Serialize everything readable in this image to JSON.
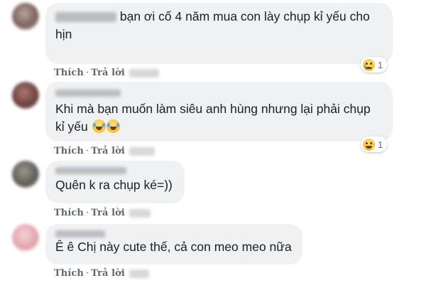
{
  "comments": [
    {
      "text": "bạn ơi cố 4 năm mua con lày chụp kỉ yếu cho hịn",
      "like": "Thích",
      "reply": "Trả lời",
      "reaction": {
        "emoji": "sad-icon",
        "count": "1"
      },
      "avatar_color": "#8a6f6a"
    },
    {
      "text": "Khi mà bạn muốn làm siêu anh hùng nhưng lại phải chụp kỉ yếu",
      "like": "Thích",
      "reply": "Trả lời",
      "reaction": {
        "emoji": "laugh-icon",
        "count": "1"
      },
      "avatar_color": "#7a4e4a"
    },
    {
      "text": "Quên k ra chụp ké=))",
      "like": "Thích",
      "reply": "Trả lời",
      "avatar_color": "#6d6a63"
    },
    {
      "text": "Ê ê Chị này cute thế, cả con meo meo nữa",
      "like": "Thích",
      "reply": "Trả lời",
      "avatar_color": "#e5a7ad"
    }
  ],
  "colors": {
    "bubble": "#eff1f3",
    "action_text": "#606770",
    "comment_text": "#1c1e21"
  }
}
